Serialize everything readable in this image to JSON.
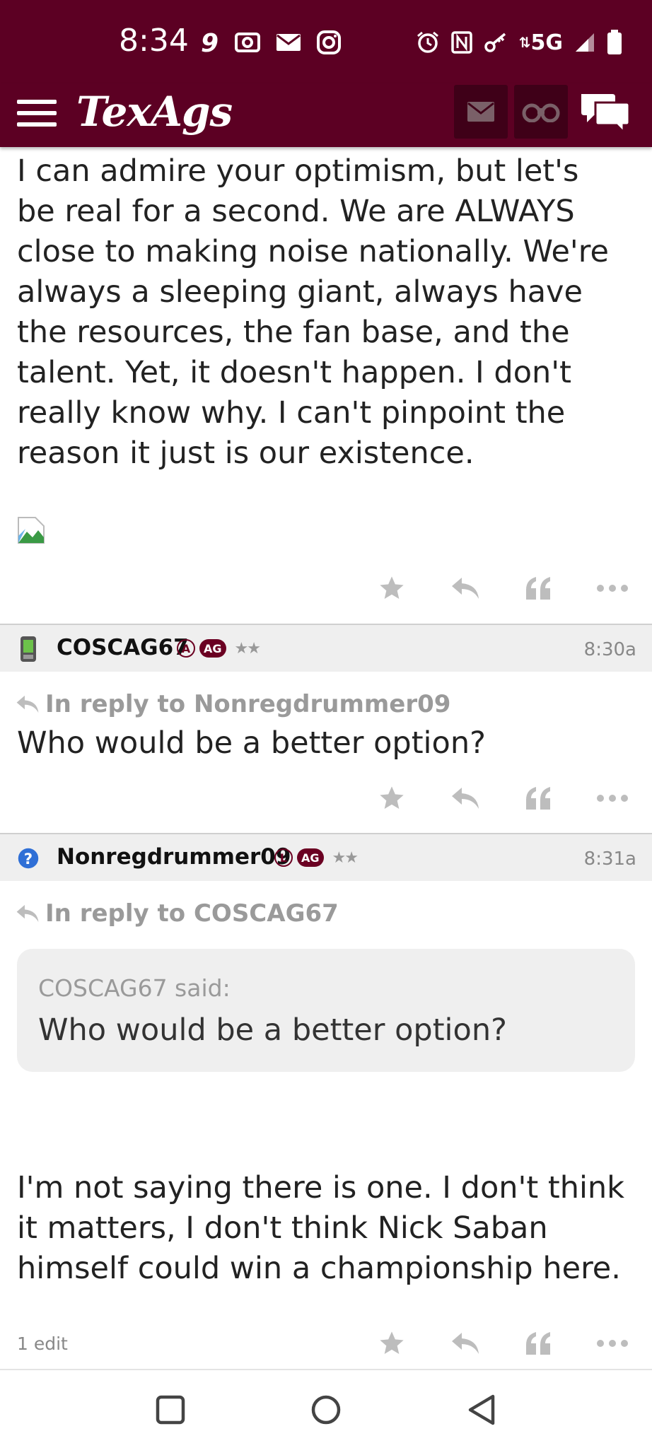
{
  "status_bar": {
    "time": "8:34",
    "network": "5G",
    "left_icons": [
      "nine-app-icon",
      "radio-icon",
      "gmail-icon",
      "instagram-icon"
    ],
    "right_icons": [
      "alarm-icon",
      "nfc-icon",
      "key-icon",
      "signal-icon",
      "battery-icon"
    ]
  },
  "header": {
    "logo": "TexAgs",
    "buttons": [
      "menu-icon",
      "mail-icon",
      "binoculars-icon",
      "chat-icon"
    ],
    "brand_color": "#5c0023"
  },
  "posts": [
    {
      "body": "I can admire your optimism, but let's be real for a second. We are ALWAYS close to making noise nationally. We're always a sleeping giant, always have the resources, the fan base, and the talent. Yet, it doesn't happen. I don't really know why. I can't pinpoint the reason it just is our existence."
    },
    {
      "username": "COSCAG67",
      "badge_letter": "A",
      "badge_ag": "AG",
      "stars": "★★",
      "time": "8:30a",
      "reply_to": "In reply to Nonregdrummer09",
      "body": "Who would be a better option?"
    },
    {
      "username": "Nonregdrummer09",
      "badge_letter": "L",
      "badge_ag": "AG",
      "stars": "★★",
      "time": "8:31a",
      "reply_to": "In reply to COSCAG67",
      "quote_attribution": "COSCAG67 said:",
      "quote_text": "Who would be a better option?",
      "body": "I'm not saying there is one. I don't think it matters, I don't think Nick Saban himself could win a championship here.",
      "edit_note": "1 edit"
    }
  ],
  "nav": [
    "recents-icon",
    "home-icon",
    "back-icon"
  ]
}
